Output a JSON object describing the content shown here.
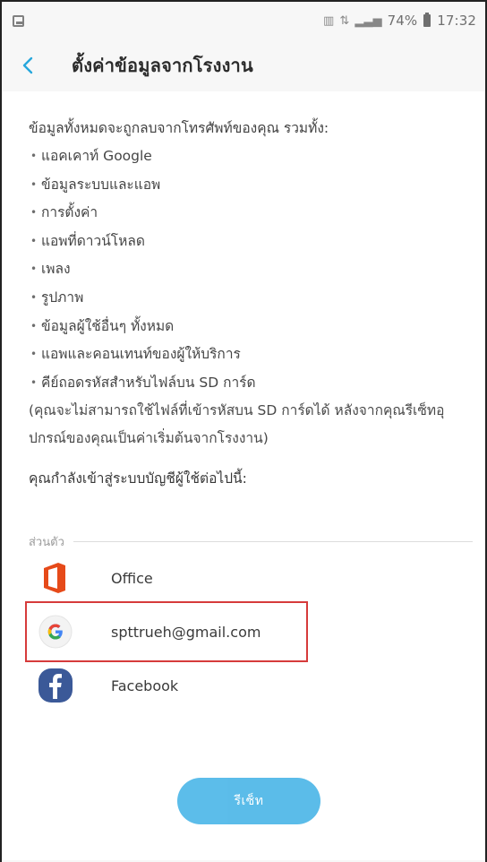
{
  "statusbar": {
    "left_icon": "image-notification-icon",
    "icons": [
      "sim-icon",
      "signal-icon"
    ],
    "battery": "74%",
    "time": "17:32"
  },
  "header": {
    "title": "ตั้งค่าข้อมูลจากโรงงาน"
  },
  "content": {
    "intro": "ข้อมูลทั้งหมดจะถูกลบจากโทรศัพท์ของคุณ รวมทั้ง:",
    "bullets": [
      "แอคเคาท์ Google",
      "ข้อมูลระบบและแอพ",
      "การตั้งค่า",
      "แอพที่ดาวน์โหลด",
      "เพลง",
      "รูปภาพ",
      "ข้อมูลผู้ใช้อื่นๆ ทั้งหมด",
      "แอพและคอนเทนท์ของผู้ให้บริการ",
      "คีย์ถอดรหัสสำหรับไฟล์บน SD การ์ด"
    ],
    "note": "(คุณจะไม่สามารถใช้ไฟล์ที่เข้ารหัสบน SD การ์ดได้ หลังจากคุณรีเซ็ทอุปกรณ์ของคุณเป็นค่าเริ่มต้นจากโรงงาน)",
    "accounts_heading": "คุณกำลังเข้าสู่ระบบบัญชีผู้ใช้ต่อไปนี้:",
    "section_label": "ส่วนตัว"
  },
  "accounts": [
    {
      "name": "Office",
      "icon": "office-icon"
    },
    {
      "name": "spttrueh@gmail.com",
      "icon": "google-icon"
    },
    {
      "name": "Facebook",
      "icon": "facebook-icon"
    }
  ],
  "reset_button": "รีเซ็ท",
  "colors": {
    "accent": "#4eb7e8",
    "highlight": "#d63b3b",
    "office": "#e64a19",
    "facebook": "#3b5998"
  }
}
